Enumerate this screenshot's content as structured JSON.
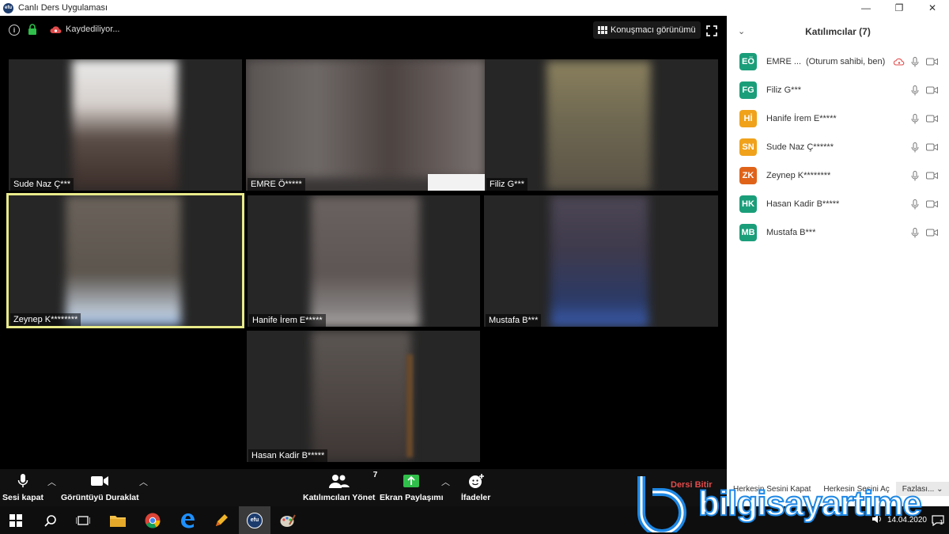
{
  "window": {
    "title": "Canlı Ders Uygulaması",
    "logo_text": "efu",
    "minimize": "—",
    "restore": "❐",
    "close": "✕"
  },
  "meeting_topbar": {
    "recording_label": "Kaydediliyor...",
    "speaker_view_label": "Konuşmacı görünümü"
  },
  "tiles": [
    {
      "name": "Sude Naz  Ç***"
    },
    {
      "name": "EMRE  Ö*****"
    },
    {
      "name": "Filiz  G***"
    },
    {
      "name": "Zeynep  K********"
    },
    {
      "name": "Hanife İrem  E*****"
    },
    {
      "name": "Mustafa  B***"
    },
    {
      "name": "Hasan Kadir  B*****"
    }
  ],
  "toolbar": {
    "mute_label": "Sesi kapat",
    "video_label": "Görüntüyü Duraklat",
    "participants_label": "Katılımcıları Yönet",
    "participants_count": "7",
    "share_label": "Ekran Paylaşımı",
    "reactions_label": "İfadeler",
    "end_label": "Dersi Bitir"
  },
  "panel": {
    "title": "Katılımcılar (7)",
    "participants": [
      {
        "initials": "EÖ",
        "name": "EMRE ...",
        "role": "(Oturum sahibi, ben)",
        "color": "#1a9e7a"
      },
      {
        "initials": "FG",
        "name": "Filiz  G***",
        "role": "",
        "color": "#1a9e7a"
      },
      {
        "initials": "Hİ",
        "name": "Hanife İrem  E*****",
        "role": "",
        "color": "#f0a21b"
      },
      {
        "initials": "SN",
        "name": "Sude Naz  Ç******",
        "role": "",
        "color": "#f0a21b"
      },
      {
        "initials": "ZK",
        "name": "Zeynep  K********",
        "role": "",
        "color": "#e0631a"
      },
      {
        "initials": "HK",
        "name": "Hasan Kadir  B*****",
        "role": "",
        "color": "#1a9e7a"
      },
      {
        "initials": "MB",
        "name": "Mustafa  B***",
        "role": "",
        "color": "#1a9e7a"
      }
    ],
    "footer": {
      "mute_all": "Herkesin Sesini Kapat",
      "unmute_all": "Herkesin Sesini Aç",
      "more": "Fazlası..."
    }
  },
  "taskbar": {
    "date": "14.04.2020",
    "notification_count": "1"
  },
  "watermark": {
    "text": "bilgisayartime"
  }
}
